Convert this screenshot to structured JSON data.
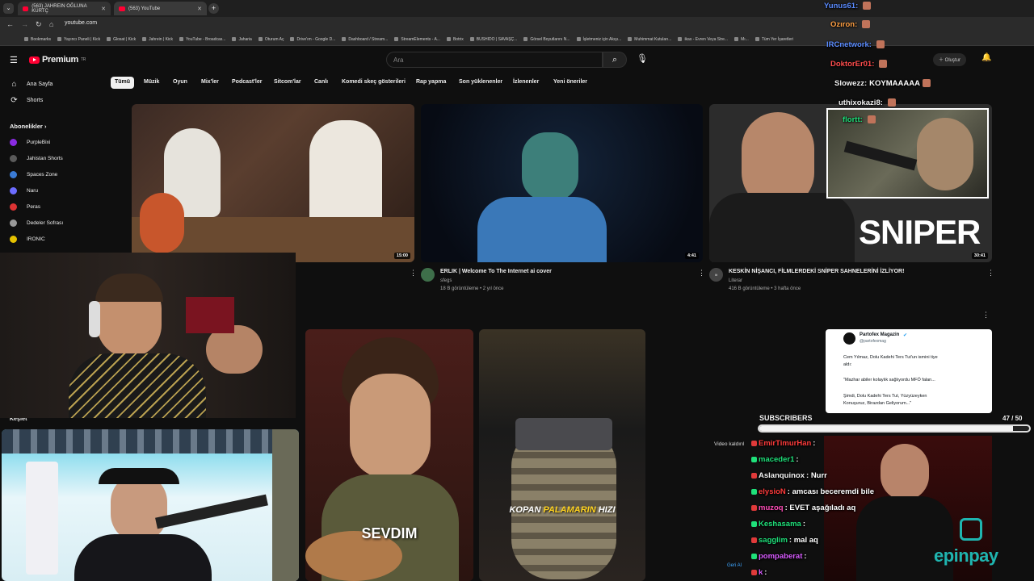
{
  "browser": {
    "tabs": [
      {
        "label": "(563) JAHREIN OĞLUNA KÜRTÇ"
      },
      {
        "label": "(563) YouTube"
      }
    ],
    "url": "youtube.com",
    "bookmarks": [
      "Bookmarks",
      "Yayıncı Paneli | Kick",
      "Glosat | Kick",
      "Jahrein | Kick",
      "YouTube - Broadcas...",
      "Jaharia",
      "Oturum Aç",
      "Drive'ım - Google D...",
      "Dashboard / Stream...",
      "StreamElements - A...",
      "Botrix",
      "BUSHIDO | SAVAŞÇ...",
      "Görsel Boyutlarını N...",
      "İşletmeniz için Akışı...",
      "Muhimmat Kutuları...",
      "ikas - Evren Veya Stre...",
      "Mı...",
      "Tüm Yer İşaretleri"
    ]
  },
  "youtube": {
    "logo": "Premium",
    "logo_sup": "TR",
    "search_placeholder": "Ara",
    "create_label": "Oluştur",
    "chips": [
      "Tümü",
      "Müzik",
      "Oyun",
      "Mix'ler",
      "Podcast'ler",
      "Sitcom'lar",
      "Canlı",
      "Komedi skeç gösterileri",
      "Rap yapma",
      "Son yüklenenler",
      "İzlenenler",
      "Yeni öneriler"
    ],
    "nav": [
      {
        "label": "Ana Sayfa",
        "icon": "home-icon"
      },
      {
        "label": "Shorts",
        "icon": "shorts-icon"
      }
    ],
    "subs_title": "Abonelikler",
    "subs": [
      {
        "label": "PurpleBixi",
        "color": "#8a2be2"
      },
      {
        "label": "Jahistan Shorts",
        "color": "#5a5a5a"
      },
      {
        "label": "Spaces Zone",
        "color": "#3a7bd5"
      },
      {
        "label": "Naru",
        "color": "#6c6cff"
      },
      {
        "label": "Peras",
        "color": "#d33"
      },
      {
        "label": "Dedeler Sofrası",
        "color": "#999"
      },
      {
        "label": "IRONIC",
        "color": "#e5c100"
      }
    ],
    "explore_label": "Keşfet",
    "videos": [
      {
        "duration": "15:00"
      },
      {
        "duration": "4:41",
        "title": "ERLIK | Welcome To The Internet ai cover",
        "channel": "sfegs",
        "meta": "18 B görüntüleme • 2 yıl önce"
      },
      {
        "duration": "30:41",
        "title": "KESKİN NİŞANCI, FİLMLERDEKİ SNİPER SAHNELERİNİ İZLİYOR!",
        "channel": "Literar",
        "meta": "416 B görüntüleme • 3 hafta önce",
        "thumb_text": "SNIPER"
      }
    ],
    "shorts": [
      {
        "caption": "SEVDIM"
      },
      {
        "caption_a": "KOPAN",
        "caption_b": "PALAMARIN",
        "caption_c": "HIZI"
      }
    ],
    "removed_label": "Video kaldırıl",
    "undo_label": "Geri Al"
  },
  "tweet": {
    "name": "Partofex Magazin",
    "handle": "@partofexmag",
    "line1": "Cem Yılmaz, Dolu Kadehi Ters Tut'un ismini tiye",
    "line2": "aldı:",
    "line3": "\"Mazhar abiler kolaylık sağlıyordu MFÖ falan...",
    "line4": "Şimdi, Dolu Kadehi Ters Tut, Yüzyüzeyken",
    "line5": "Konuşuruz, Birazdan Geliyorum...\""
  },
  "subgoal": {
    "label": "SUBSCRIBERS",
    "current": 47,
    "target": 50,
    "text": "47 / 50"
  },
  "chat_top": [
    {
      "user": "Yunus61:",
      "msg": "",
      "color": "#5b8cff"
    },
    {
      "user": "Ozıron:",
      "msg": "",
      "color": "#ff9f43"
    },
    {
      "user": "IRCnetwork:",
      "msg": "",
      "color": "#5b8cff"
    },
    {
      "user": "DoktorEr01:",
      "msg": "",
      "color": "#ff4d4d"
    },
    {
      "user": "Slowezz:",
      "msg": "KOYMAAAAA",
      "color": "#f1f1f1"
    },
    {
      "user": "uthixokazi8:",
      "msg": "",
      "color": "#f1f1f1"
    },
    {
      "user": "flortt:",
      "msg": "",
      "color": "#1fe07a"
    }
  ],
  "chat_bottom": [
    {
      "user": "EmirTimurHan",
      "msg": ":",
      "color": "#ff3b3b"
    },
    {
      "user": "maceder1",
      "msg": ":",
      "color": "#1fe07a"
    },
    {
      "user": "Aslanquinox",
      "msg": ": Nurr",
      "color": "#f1f1f1"
    },
    {
      "user": "elysioN",
      "msg": ": amcası beceremdi bile",
      "color": "#ff3b3b"
    },
    {
      "user": "muzoq",
      "msg": ": EVET aşağıladı aq",
      "color": "#ff4db8"
    },
    {
      "user": "Keshasama",
      "msg": ":",
      "color": "#1fe07a"
    },
    {
      "user": "sagglim",
      "msg": ": mal aq",
      "color": "#1fe07a"
    },
    {
      "user": "pompaberat",
      "msg": ":",
      "color": "#d85bff"
    },
    {
      "user": "k",
      "msg": ":",
      "color": "#d85bff"
    }
  ],
  "sponsor": {
    "text": "epinpay",
    "color": "#1fb5b0"
  }
}
